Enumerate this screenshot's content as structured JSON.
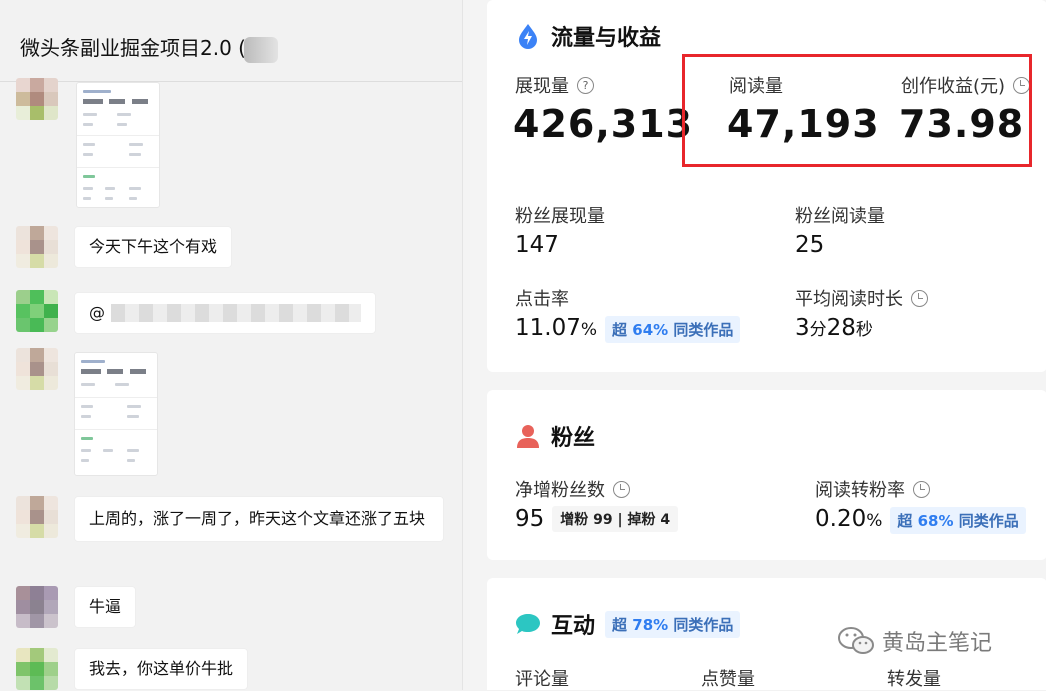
{
  "chat": {
    "group_title": "微头条副业掘金项目2.0 (",
    "messages": [
      {
        "type": "image"
      },
      {
        "type": "text",
        "text": "今天下午这个有戏"
      },
      {
        "type": "mention",
        "text": "@"
      },
      {
        "type": "image"
      },
      {
        "type": "text",
        "text": "上周的，涨了一周了，昨天这个文章还涨了五块"
      },
      {
        "type": "text",
        "text": "牛逼"
      },
      {
        "type": "text",
        "text": "我去，你这单价牛批"
      }
    ]
  },
  "traffic": {
    "title": "流量与收益",
    "impressions_label": "展现量",
    "impressions": "426,313",
    "reads_label": "阅读量",
    "reads": "47,193",
    "income_label": "创作收益(元)",
    "income": "73.98",
    "fan_impr_label": "粉丝展现量",
    "fan_impr": "147",
    "fan_reads_label": "粉丝阅读量",
    "fan_reads": "25",
    "ctr_label": "点击率",
    "ctr": "11.07",
    "ctr_unit": "%",
    "ctr_badge_prefix": "超",
    "ctr_badge_pct": "64%",
    "ctr_badge_suffix": "同类作品",
    "avg_time_label": "平均阅读时长",
    "avg_min": "3",
    "avg_min_unit": "分",
    "avg_sec": "28",
    "avg_sec_unit": "秒"
  },
  "fans": {
    "title": "粉丝",
    "net_label": "净增粉丝数",
    "net": "95",
    "gain_label": "增粉",
    "gain": "99",
    "lose_label": "掉粉",
    "lose": "4",
    "conv_label": "阅读转粉率",
    "conv": "0.20",
    "conv_unit": "%",
    "conv_badge_prefix": "超",
    "conv_badge_pct": "68%",
    "conv_badge_suffix": "同类作品"
  },
  "interaction": {
    "title": "互动",
    "badge_prefix": "超",
    "badge_pct": "78%",
    "badge_suffix": "同类作品",
    "comments_label": "评论量",
    "likes_label": "点赞量",
    "shares_label": "转发量"
  },
  "watermark": {
    "text": "黄岛主笔记"
  },
  "colors": {
    "highlight": "#e8262b",
    "accent_blue": "#2f7df0",
    "badge_bg": "#eaf3ff"
  }
}
